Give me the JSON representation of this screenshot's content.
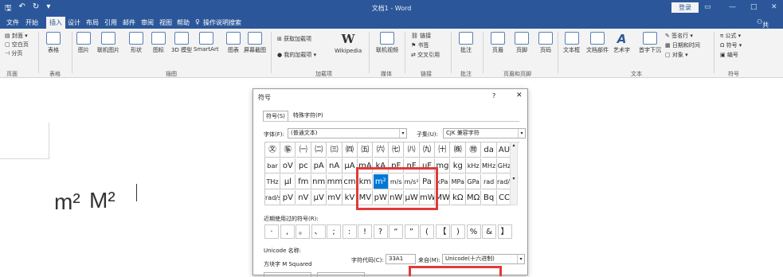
{
  "window": {
    "title": "文档1 - Word",
    "login": "登录",
    "share": "共享"
  },
  "quick_access": {
    "save": "🖫",
    "undo": "↶",
    "redo": "↻",
    "more": "▾"
  },
  "menu": [
    "文件",
    "开始",
    "插入",
    "设计",
    "布局",
    "引用",
    "邮件",
    "审阅",
    "视图",
    "帮助"
  ],
  "menu_search": "操作说明搜索",
  "ribbon": {
    "pages": [
      "封面",
      "空白页",
      "分页"
    ],
    "buttons": [
      "表格",
      "图片",
      "联机图片",
      "形状",
      "图标",
      "3D 模型",
      "SmartArt",
      "图表",
      "屏幕截图",
      "获取加载项",
      "我的加载项",
      "Wikipedia",
      "联机视频",
      "链接",
      "书签",
      "交叉引用",
      "批注",
      "页眉",
      "页脚",
      "页码",
      "文本框",
      "文档部件",
      "艺术字",
      "首字下沉",
      "签名行",
      "日期和时间",
      "对象",
      "公式",
      "符号",
      "编号"
    ],
    "groups": [
      "页面",
      "表格",
      "插图",
      "加载项",
      "媒体",
      "链接",
      "批注",
      "页眉和页脚",
      "文本",
      "符号"
    ]
  },
  "document": {
    "text1": "m²",
    "text2": "M²"
  },
  "dialog": {
    "title": "符号",
    "help": "?",
    "close": "✕",
    "tabs": [
      "符号(S)",
      "特殊字符(P)"
    ],
    "font_label": "字体(F):",
    "font_value": "(普通文本)",
    "subset_label": "子集(U):",
    "subset_value": "CJK 兼容字符",
    "grid": [
      [
        "㉆",
        "㉇",
        "㈠",
        "㈡",
        "㈢",
        "㈣",
        "㈤",
        "㈥",
        "㈦",
        "㈧",
        "㈨",
        "㈩",
        "㈱",
        "㉄",
        "da",
        "AU"
      ],
      [
        "bar",
        "oV",
        "pc",
        "pA",
        "nA",
        "μA",
        "mA",
        "kA",
        "pF",
        "nF",
        "μF",
        "mg",
        "kg",
        "kHz",
        "MHz",
        "GHz"
      ],
      [
        "THz",
        "μl",
        "fm",
        "nm",
        "mm",
        "cm",
        "km",
        "m²",
        "m/s",
        "m/s²",
        "Pa",
        "kPa",
        "MPa",
        "GPa",
        "rad",
        "rad/s"
      ],
      [
        "rad/s²",
        "pV",
        "nV",
        "μV",
        "mV",
        "kV",
        "MV",
        "pW",
        "nW",
        "μW",
        "mW",
        "MW",
        "kΩ",
        "MΩ",
        "Bq",
        "CC"
      ]
    ],
    "recent_label": "近期使用过的符号(R):",
    "recent": [
      "·",
      ",",
      "。",
      "、",
      ";",
      ":",
      "!",
      "?",
      "“",
      "”",
      "(",
      "【",
      ")",
      "%",
      "&",
      "】"
    ],
    "unicode_name_label": "Unicode 名称:",
    "unicode_name": "方块字 M Squared",
    "code_label": "字符代码(C):",
    "code_value": "33A1",
    "from_label": "来自(M):",
    "from_value": "Unicode(十六进制)"
  }
}
